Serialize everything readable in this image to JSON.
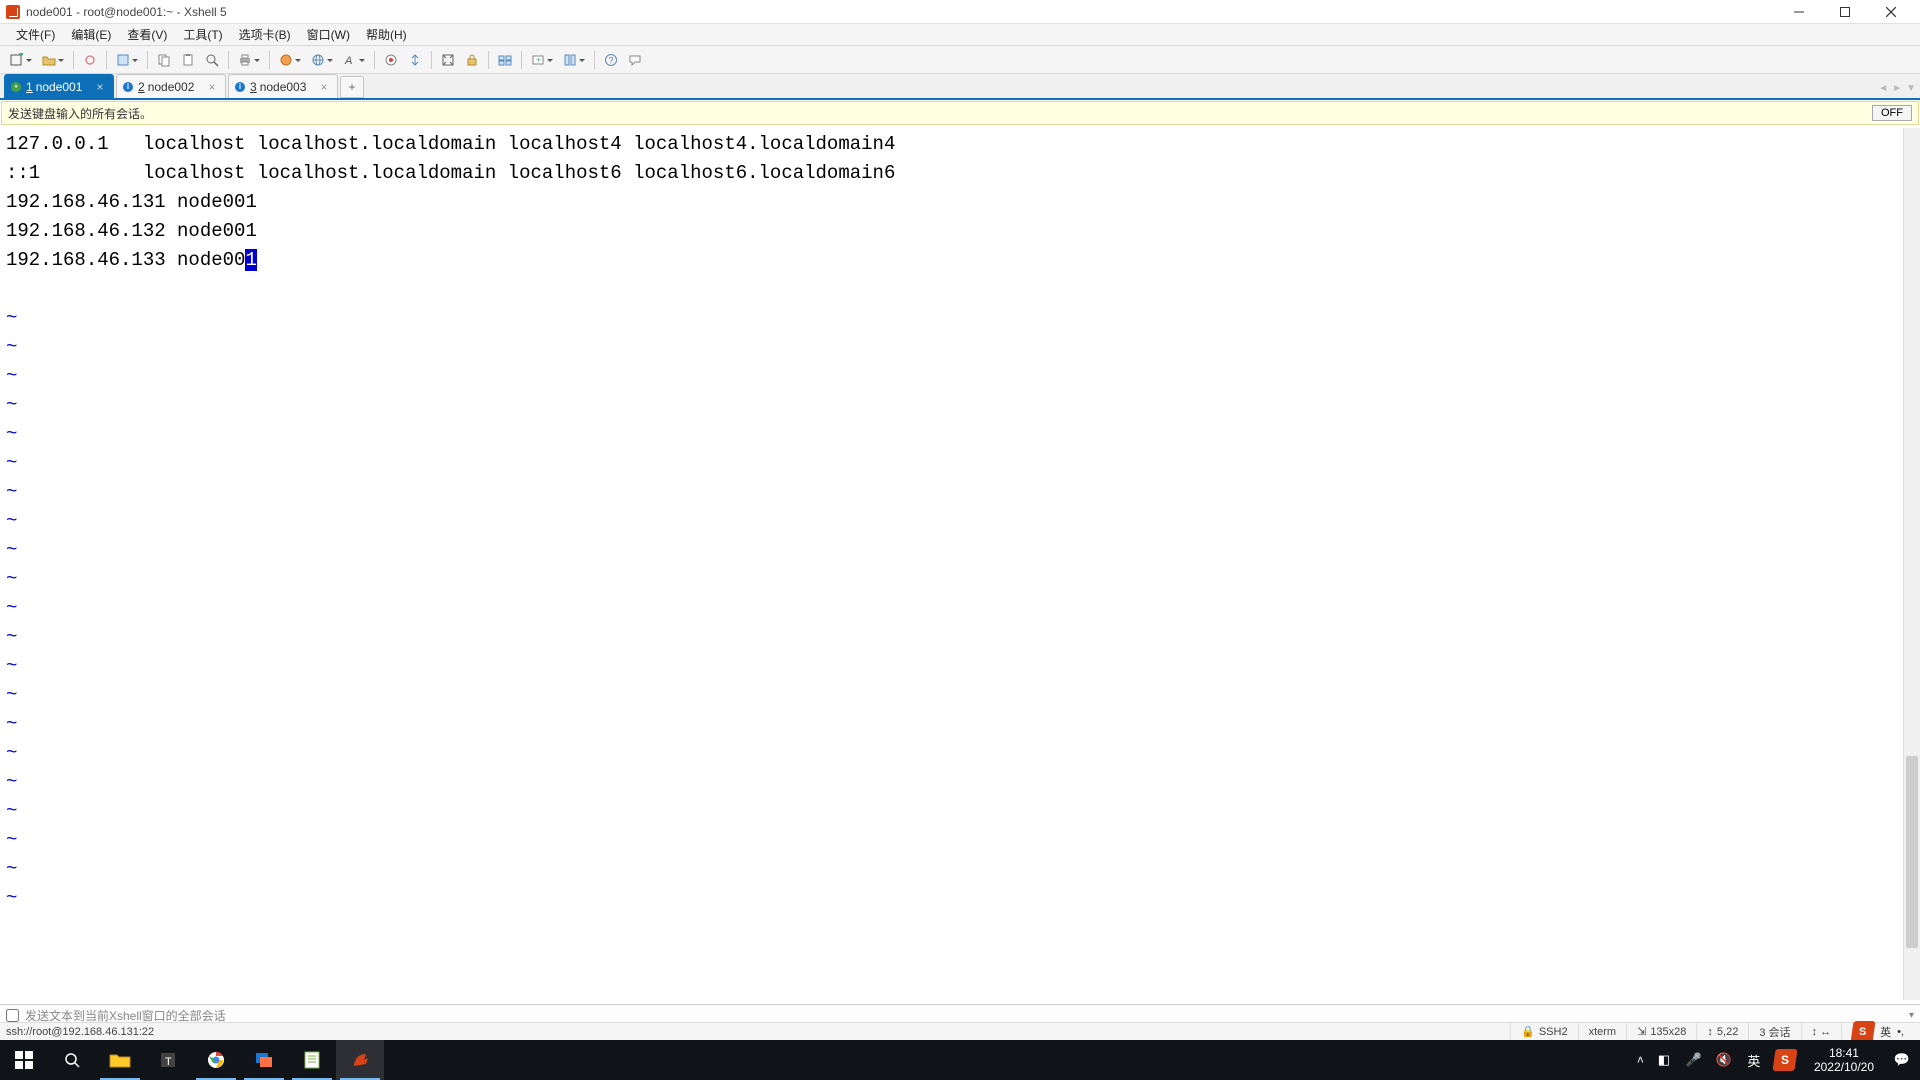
{
  "window": {
    "title": "node001 - root@node001:~ - Xshell 5"
  },
  "menu": {
    "items": [
      "文件(F)",
      "编辑(E)",
      "查看(V)",
      "工具(T)",
      "选项卡(B)",
      "窗口(W)",
      "帮助(H)"
    ]
  },
  "tabs": {
    "items": [
      {
        "num": "1",
        "label": "node001",
        "active": true
      },
      {
        "num": "2",
        "label": "node002",
        "active": false
      },
      {
        "num": "3",
        "label": "node003",
        "active": false
      }
    ]
  },
  "broadcast": {
    "text": "发送键盘输入的所有会话。",
    "button": "OFF"
  },
  "terminal": {
    "lines": [
      "127.0.0.1   localhost localhost.localdomain localhost4 localhost4.localdomain4",
      "::1         localhost localhost.localdomain localhost6 localhost6.localdomain6",
      "192.168.46.131 node001",
      "192.168.46.132 node001",
      "192.168.46.133 node00"
    ],
    "cursor_char": "1"
  },
  "sendbar": {
    "placeholder": "发送文本到当前Xshell窗口的全部会话"
  },
  "status": {
    "left": "ssh://root@192.168.46.131:22",
    "proto": "SSH2",
    "term": "xterm",
    "size": "135x28",
    "pos": "5,22",
    "sessions": "3 会话"
  },
  "tray": {
    "ime1": "英",
    "ime2": "S",
    "ime3": "英",
    "time": "18:41",
    "date": "2022/10/20"
  }
}
